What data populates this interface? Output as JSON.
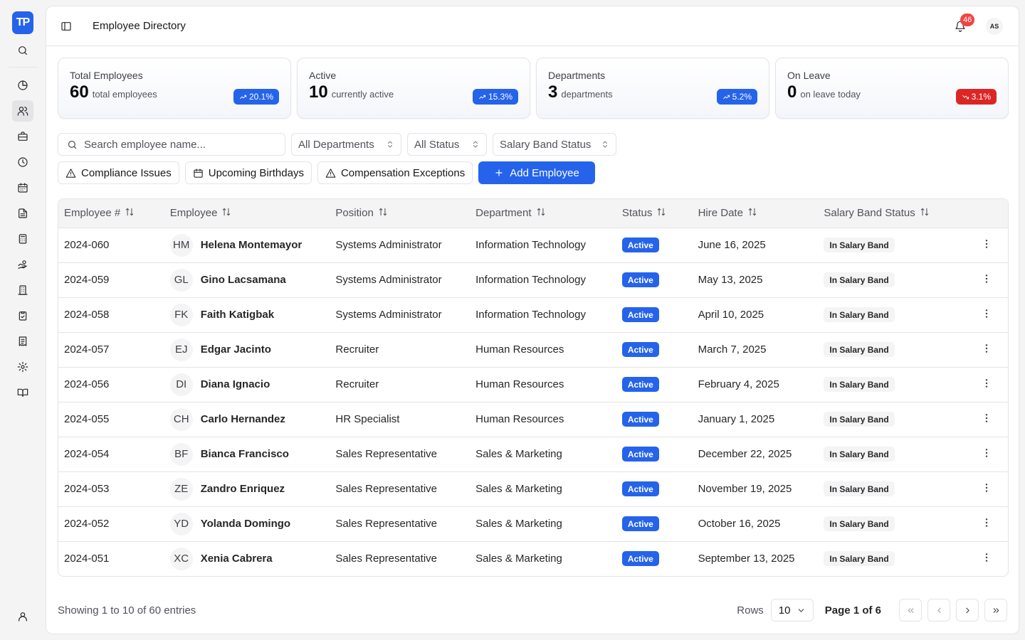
{
  "app": {
    "logo_text": "TP"
  },
  "header": {
    "title": "Employee Directory",
    "notification_count": "46",
    "user_initials": "AS"
  },
  "sidebar": {
    "items": [
      {
        "name": "search-icon"
      },
      {
        "name": "dashboard-pie-icon"
      },
      {
        "name": "users-icon",
        "active": true
      },
      {
        "name": "briefcase-icon"
      },
      {
        "name": "clock-icon"
      },
      {
        "name": "calendar-icon"
      },
      {
        "name": "document-icon"
      },
      {
        "name": "calculator-icon"
      },
      {
        "name": "hand-coins-icon"
      },
      {
        "name": "building-icon"
      },
      {
        "name": "clipboard-check-icon"
      },
      {
        "name": "receipt-icon"
      },
      {
        "name": "gear-icon"
      },
      {
        "name": "book-open-icon"
      }
    ],
    "bottom": "user-icon"
  },
  "stats": [
    {
      "label": "Total Employees",
      "value": "60",
      "sub": "total employees",
      "change": "20.1%",
      "trend": "up"
    },
    {
      "label": "Active",
      "value": "10",
      "sub": "currently active",
      "change": "15.3%",
      "trend": "up"
    },
    {
      "label": "Departments",
      "value": "3",
      "sub": "departments",
      "change": "5.2%",
      "trend": "up"
    },
    {
      "label": "On Leave",
      "value": "0",
      "sub": "on leave today",
      "change": "3.1%",
      "trend": "down"
    }
  ],
  "filters": {
    "search_placeholder": "Search employee name...",
    "department": "All Departments",
    "status": "All Status",
    "salary_band": "Salary Band Status"
  },
  "actions": {
    "compliance": "Compliance Issues",
    "birthdays": "Upcoming Birthdays",
    "exceptions": "Compensation Exceptions",
    "add": "Add Employee"
  },
  "table": {
    "columns": [
      "Employee #",
      "Employee",
      "Position",
      "Department",
      "Status",
      "Hire Date",
      "Salary Band Status"
    ],
    "rows": [
      {
        "id": "2024-060",
        "initials": "HM",
        "name": "Helena Montemayor",
        "position": "Systems Administrator",
        "department": "Information Technology",
        "status": "Active",
        "hire_date": "June 16, 2025",
        "band": "In Salary Band"
      },
      {
        "id": "2024-059",
        "initials": "GL",
        "name": "Gino Lacsamana",
        "position": "Systems Administrator",
        "department": "Information Technology",
        "status": "Active",
        "hire_date": "May 13, 2025",
        "band": "In Salary Band"
      },
      {
        "id": "2024-058",
        "initials": "FK",
        "name": "Faith Katigbak",
        "position": "Systems Administrator",
        "department": "Information Technology",
        "status": "Active",
        "hire_date": "April 10, 2025",
        "band": "In Salary Band"
      },
      {
        "id": "2024-057",
        "initials": "EJ",
        "name": "Edgar Jacinto",
        "position": "Recruiter",
        "department": "Human Resources",
        "status": "Active",
        "hire_date": "March 7, 2025",
        "band": "In Salary Band"
      },
      {
        "id": "2024-056",
        "initials": "DI",
        "name": "Diana Ignacio",
        "position": "Recruiter",
        "department": "Human Resources",
        "status": "Active",
        "hire_date": "February 4, 2025",
        "band": "In Salary Band"
      },
      {
        "id": "2024-055",
        "initials": "CH",
        "name": "Carlo Hernandez",
        "position": "HR Specialist",
        "department": "Human Resources",
        "status": "Active",
        "hire_date": "January 1, 2025",
        "band": "In Salary Band"
      },
      {
        "id": "2024-054",
        "initials": "BF",
        "name": "Bianca Francisco",
        "position": "Sales Representative",
        "department": "Sales & Marketing",
        "status": "Active",
        "hire_date": "December 22, 2025",
        "band": "In Salary Band"
      },
      {
        "id": "2024-053",
        "initials": "ZE",
        "name": "Zandro Enriquez",
        "position": "Sales Representative",
        "department": "Sales & Marketing",
        "status": "Active",
        "hire_date": "November 19, 2025",
        "band": "In Salary Band"
      },
      {
        "id": "2024-052",
        "initials": "YD",
        "name": "Yolanda Domingo",
        "position": "Sales Representative",
        "department": "Sales & Marketing",
        "status": "Active",
        "hire_date": "October 16, 2025",
        "band": "In Salary Band"
      },
      {
        "id": "2024-051",
        "initials": "XC",
        "name": "Xenia Cabrera",
        "position": "Sales Representative",
        "department": "Sales & Marketing",
        "status": "Active",
        "hire_date": "September 13, 2025",
        "band": "In Salary Band"
      }
    ]
  },
  "footer": {
    "showing": "Showing 1 to 10 of 60 entries",
    "rows_label": "Rows",
    "rows_value": "10",
    "page_info": "Page 1 of 6"
  },
  "colors": {
    "accent": "#2563eb",
    "danger": "#dc2626",
    "badge": "#ef4444"
  }
}
